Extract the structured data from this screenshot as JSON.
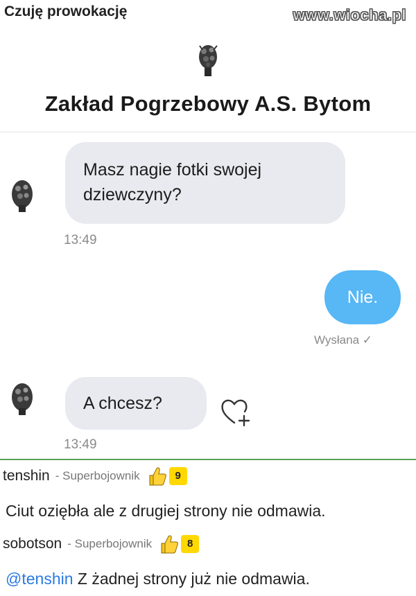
{
  "post": {
    "title": "Czuję prowokację",
    "watermark": "www.wiocha.pl"
  },
  "chat": {
    "page_name": "Zakład Pogrzebowy A.S. Bytom",
    "messages": [
      {
        "from": "them",
        "text_line1": "Masz nagie fotki swojej",
        "text_line2": "dziewczyny?",
        "time": "13:49"
      },
      {
        "from": "me",
        "text": "Nie.",
        "status": "Wysłana ✓"
      },
      {
        "from": "them",
        "text": "A chcesz?",
        "time": "13:49"
      }
    ]
  },
  "comments": [
    {
      "user": "tenshin",
      "rank": "- Superbojownik",
      "votes": "9",
      "text": "Ciut oziębła ale z drugiej strony nie odmawia."
    },
    {
      "user": "sobotson",
      "rank": "- Superbojownik",
      "votes": "8",
      "mention": "@tenshin",
      "text": " Z żadnej strony już nie odmawia."
    }
  ],
  "colors": {
    "bubble_in": "#e9eaef",
    "bubble_out": "#58b7f5",
    "vote_badge": "#ffd800",
    "mention": "#2a7ae2"
  },
  "icons": [
    "wreath-logo-icon",
    "wreath-avatar-icon",
    "heart-plus-icon",
    "thumbs-up-icon"
  ]
}
